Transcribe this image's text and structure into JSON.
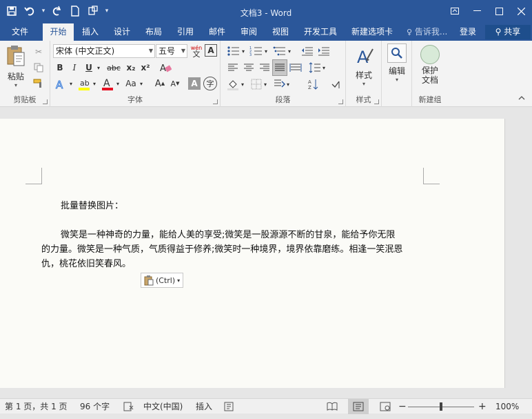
{
  "window": {
    "title": "文档3 - Word"
  },
  "tabs": [
    {
      "label": "文件"
    },
    {
      "label": "开始"
    },
    {
      "label": "插入"
    },
    {
      "label": "设计"
    },
    {
      "label": "布局"
    },
    {
      "label": "引用"
    },
    {
      "label": "邮件"
    },
    {
      "label": "审阅"
    },
    {
      "label": "视图"
    },
    {
      "label": "开发工具"
    },
    {
      "label": "新建选项卡"
    }
  ],
  "tell_me": "告诉我...",
  "login": "登录",
  "share": "共享",
  "ribbon": {
    "clipboard": {
      "label": "剪贴板",
      "paste": "粘贴"
    },
    "font": {
      "label": "字体",
      "font_name": "宋体 (中文正文)",
      "font_size": "五号",
      "phonetic": "wén",
      "bold": "B",
      "italic": "I",
      "underline": "U",
      "strike": "abc",
      "subscript": "x₂",
      "superscript": "x²",
      "change_case": "Aa",
      "grow": "A",
      "shrink": "A",
      "shade_char": "A",
      "circle_char": "字"
    },
    "paragraph": {
      "label": "段落"
    },
    "styles": {
      "label": "样式",
      "button": "样式"
    },
    "editing": {
      "button": "编辑"
    },
    "newgroup": {
      "label": "新建组",
      "protect": "保护\n文档"
    }
  },
  "document": {
    "line1": "批量替换图片：",
    "para2_line1": "微笑是一种神奇的力量，能给人美的享受;微笑是一股源源不断的甘泉，能给予你无限",
    "para2_line2": "的力量。微笑是一种气质，气质得益于修养;微笑时一种境界，境界依靠磨练。相逢一笑泯恩",
    "para2_line3": "仇，桃花依旧笑春风。",
    "paste_options": "(Ctrl)"
  },
  "status": {
    "page": "第 1 页，共 1 页",
    "words": "96 个字",
    "language": "中文(中国)",
    "mode": "插入",
    "zoom": "100%",
    "zoom_level": 1.0
  }
}
